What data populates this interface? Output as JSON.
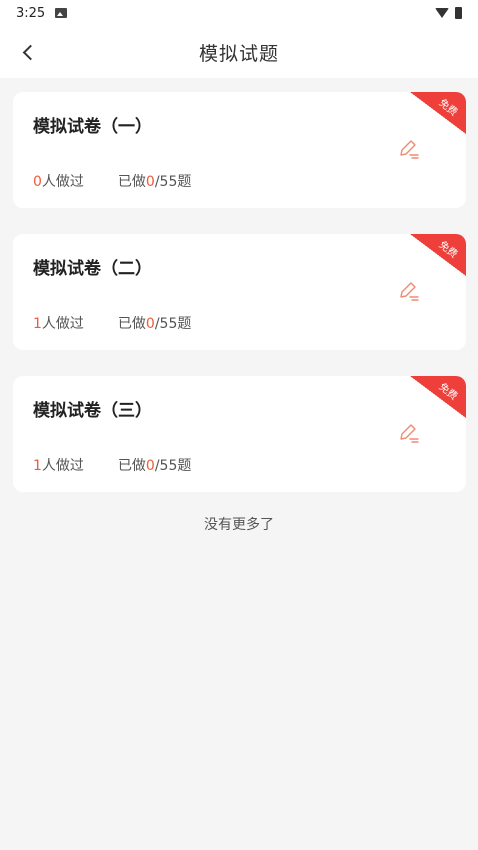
{
  "status_bar": {
    "time": "3:25",
    "image_icon": "image-icon",
    "wifi_icon": "wifi-icon",
    "battery_icon": "battery-icon"
  },
  "nav": {
    "title": "模拟试题",
    "back_icon": "chevron-left-icon"
  },
  "accent_color": "#ef5b3a",
  "ribbon_color": "#ef3f3a",
  "cards": [
    {
      "title": "模拟试卷（一）",
      "badge": "免费",
      "people_count": "0",
      "people_suffix": "人做过",
      "done_prefix": "已做",
      "done_count": "0",
      "done_total": "/55题",
      "edit_icon": "edit-pen-icon"
    },
    {
      "title": "模拟试卷（二）",
      "badge": "免费",
      "people_count": "1",
      "people_suffix": "人做过",
      "done_prefix": "已做",
      "done_count": "0",
      "done_total": "/55题",
      "edit_icon": "edit-pen-icon"
    },
    {
      "title": "模拟试卷（三）",
      "badge": "免费",
      "people_count": "1",
      "people_suffix": "人做过",
      "done_prefix": "已做",
      "done_count": "0",
      "done_total": "/55题",
      "edit_icon": "edit-pen-icon"
    }
  ],
  "footer": {
    "no_more_text": "没有更多了"
  }
}
